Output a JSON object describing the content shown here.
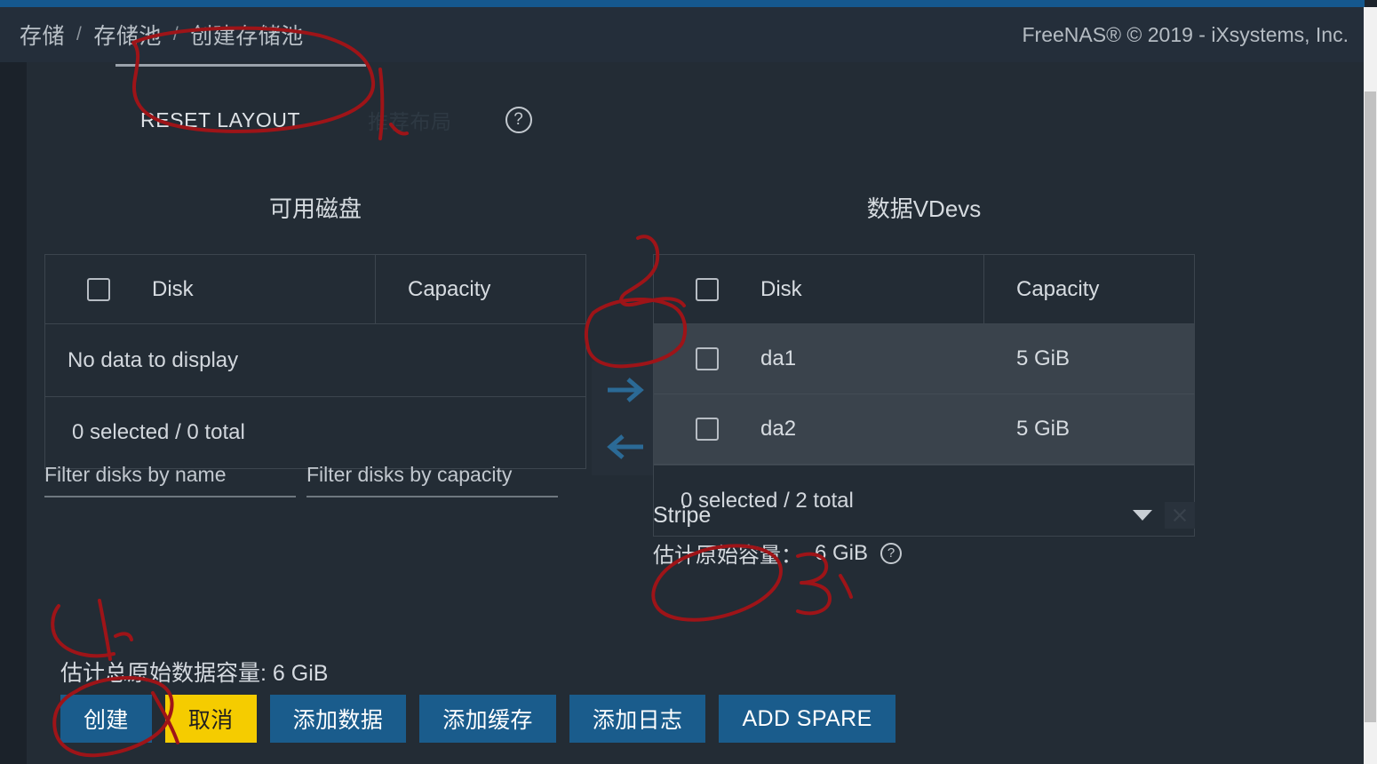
{
  "header": {
    "breadcrumb": [
      "存储",
      "存储池",
      "创建存储池"
    ],
    "separator": "/",
    "brand": "FreeNAS® © 2019 - iXsystems, Inc.",
    "accent_color": "#15588e"
  },
  "toolbar": {
    "reset_layout_label": "RESET LAYOUT",
    "suggest_layout_label": "推荐布局",
    "help_icon": "help-circle-icon",
    "help_glyph": "?"
  },
  "available_disks": {
    "title": "可用磁盘",
    "columns": [
      "Disk",
      "Capacity"
    ],
    "empty_text": "No data to display",
    "footer": "0 selected / 0 total",
    "rows": []
  },
  "transfer": {
    "move_right_icon": "arrow-right-icon",
    "move_left_icon": "arrow-left-icon",
    "arrow_color": "#2b6a96"
  },
  "data_vdevs": {
    "title": "数据VDevs",
    "columns": [
      "Disk",
      "Capacity"
    ],
    "footer": "0 selected / 2 total",
    "rows": [
      {
        "disk": "da1",
        "capacity": "5 GiB"
      },
      {
        "disk": "da2",
        "capacity": "5 GiB"
      }
    ]
  },
  "filters": {
    "name_value": "",
    "name_placeholder": "Filter disks by name",
    "capacity_value": "",
    "capacity_placeholder": "Filter disks by capacity"
  },
  "vdev_type": {
    "selected": "Stripe",
    "caret_icon": "chevron-down-icon",
    "clear_icon": "close-icon",
    "raw_capacity_label": "估计原始容量：",
    "raw_capacity_value": "6 GiB",
    "help_glyph": "?"
  },
  "totals": {
    "text": "估计总原始数据容量: 6 GiB"
  },
  "actions": {
    "buttons": [
      {
        "label": "创建",
        "style": "primary"
      },
      {
        "label": "取消",
        "style": "warn"
      },
      {
        "label": "添加数据",
        "style": "primary"
      },
      {
        "label": "添加缓存",
        "style": "primary"
      },
      {
        "label": "添加日志",
        "style": "primary"
      },
      {
        "label": "ADD SPARE",
        "style": "primary"
      }
    ],
    "primary_color": "#1a5c8c",
    "warn_color": "#f5cc00"
  },
  "annotations": {
    "ink_color": "#9e1418",
    "marks": [
      "circle-reset-layout",
      "circle-move-right-arrow",
      "circle-stripe",
      "digit-3",
      "circle-create-button",
      "mark-4"
    ]
  },
  "scrollbar": {
    "track_color": "#f1f1f1",
    "thumb_color": "#c1c1c1"
  }
}
